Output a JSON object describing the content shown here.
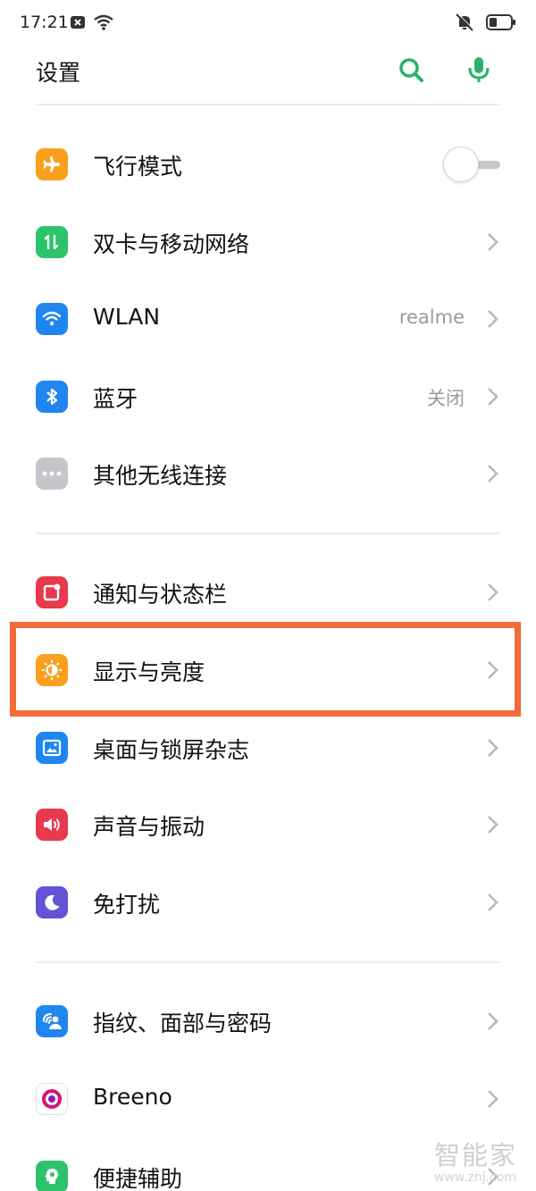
{
  "status_bar": {
    "time": "17:21",
    "icons_left": [
      "close-icon",
      "wifi-icon"
    ],
    "icons_right": [
      "mute-vibrate-icon",
      "battery-icon"
    ]
  },
  "header": {
    "title": "设置",
    "search_icon": "search-icon",
    "mic_icon": "mic-icon",
    "accent_color": "#27b36b"
  },
  "settings": [
    {
      "id": "airplane",
      "label": "飞行模式",
      "icon": "airplane-icon",
      "color": "#f8a01d",
      "control": "toggle",
      "toggle_on": false
    },
    {
      "id": "dual-sim",
      "label": "双卡与移动网络",
      "icon": "mobile-data-icon",
      "color": "#2cc36b",
      "control": "chevron"
    },
    {
      "id": "wlan",
      "label": "WLAN",
      "icon": "wifi-icon",
      "color": "#1f86f0",
      "control": "chevron",
      "value": "realme"
    },
    {
      "id": "bluetooth",
      "label": "蓝牙",
      "icon": "bluetooth-icon",
      "color": "#1f86f0",
      "control": "chevron",
      "value": "关闭"
    },
    {
      "id": "other-wireless",
      "label": "其他无线连接",
      "icon": "more-dots-icon",
      "color": "#c4c6cc",
      "control": "chevron"
    },
    {
      "id": "notifications",
      "label": "通知与状态栏",
      "icon": "notification-icon",
      "color": "#e8394d",
      "control": "chevron"
    },
    {
      "id": "display",
      "label": "显示与亮度",
      "icon": "brightness-icon",
      "color": "#f8a01d",
      "control": "chevron",
      "highlighted": true
    },
    {
      "id": "wallpaper",
      "label": "桌面与锁屏杂志",
      "icon": "wallpaper-icon",
      "color": "#1f86f0",
      "control": "chevron"
    },
    {
      "id": "sound",
      "label": "声音与振动",
      "icon": "speaker-icon",
      "color": "#e8394d",
      "control": "chevron"
    },
    {
      "id": "dnd",
      "label": "免打扰",
      "icon": "moon-icon",
      "color": "#6353d6",
      "control": "chevron"
    },
    {
      "id": "security",
      "label": "指纹、面部与密码",
      "icon": "fingerprint-face-icon",
      "color": "#1f86f0",
      "control": "chevron"
    },
    {
      "id": "breeno",
      "label": "Breeno",
      "icon": "breeno-icon",
      "color": "#d4147a",
      "control": "chevron"
    },
    {
      "id": "accessibility",
      "label": "便捷辅助",
      "icon": "accessibility-icon",
      "color": "#2cc36b",
      "control": "chevron"
    }
  ],
  "highlight_color": "#f26b39",
  "watermark": {
    "main": "智能家",
    "sub": "www.znj.com"
  }
}
